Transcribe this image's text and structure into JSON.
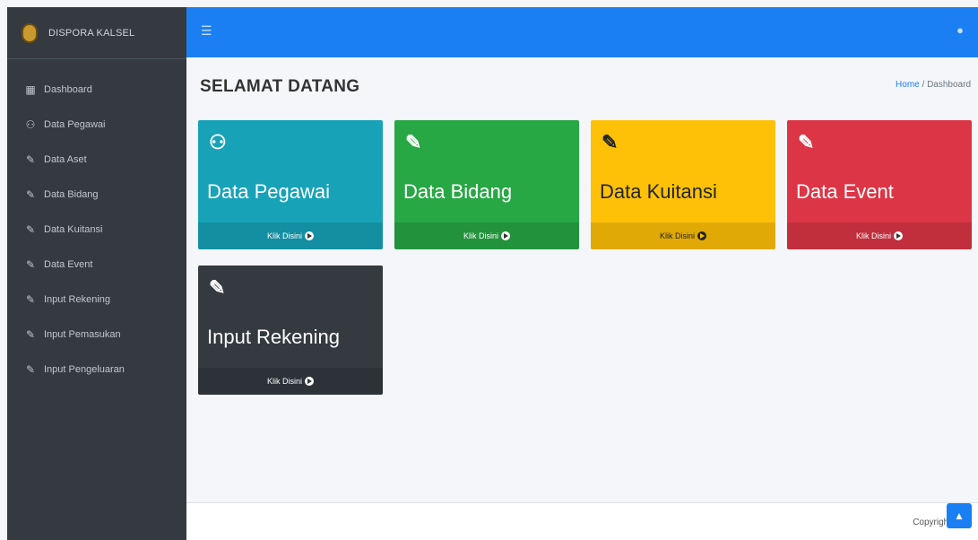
{
  "brand": {
    "name": "DISPORA KALSEL",
    "logo_icon": "emblem-logo"
  },
  "sidebar": {
    "items": [
      {
        "label": "Dashboard",
        "icon": "grid-icon"
      },
      {
        "label": "Data Pegawai",
        "icon": "users-icon"
      },
      {
        "label": "Data Aset",
        "icon": "edit-icon"
      },
      {
        "label": "Data Bidang",
        "icon": "edit-icon"
      },
      {
        "label": "Data Kuitansi",
        "icon": "edit-icon"
      },
      {
        "label": "Data Event",
        "icon": "edit-icon"
      },
      {
        "label": "Input Rekening",
        "icon": "edit-icon"
      },
      {
        "label": "Input Pemasukan",
        "icon": "edit-icon"
      },
      {
        "label": "Input Pengeluaran",
        "icon": "edit-icon"
      }
    ]
  },
  "topbar": {
    "menu_icon": "hamburger-icon",
    "user_icon": "user-icon",
    "color": "#1a7ff2"
  },
  "page": {
    "title": "SELAMAT DATANG",
    "breadcrumb": {
      "home": "Home",
      "separator": "/",
      "current": "Dashboard"
    }
  },
  "cards": [
    {
      "title": "Data Pegawai",
      "link": "Klik Disini",
      "icon": "users-icon",
      "color": "#17a2b8"
    },
    {
      "title": "Data Bidang",
      "link": "Klik Disini",
      "icon": "edit-icon",
      "color": "#28a745"
    },
    {
      "title": "Data Kuitansi",
      "link": "Klik Disini",
      "icon": "edit-icon",
      "color": "#ffc107"
    },
    {
      "title": "Data Event",
      "link": "Klik Disini",
      "icon": "edit-icon",
      "color": "#dc3545"
    },
    {
      "title": "Input Rekening",
      "link": "Klik Disini",
      "icon": "edit-icon",
      "color": "#343a40"
    }
  ],
  "footer": {
    "copyright": "Copyright"
  }
}
